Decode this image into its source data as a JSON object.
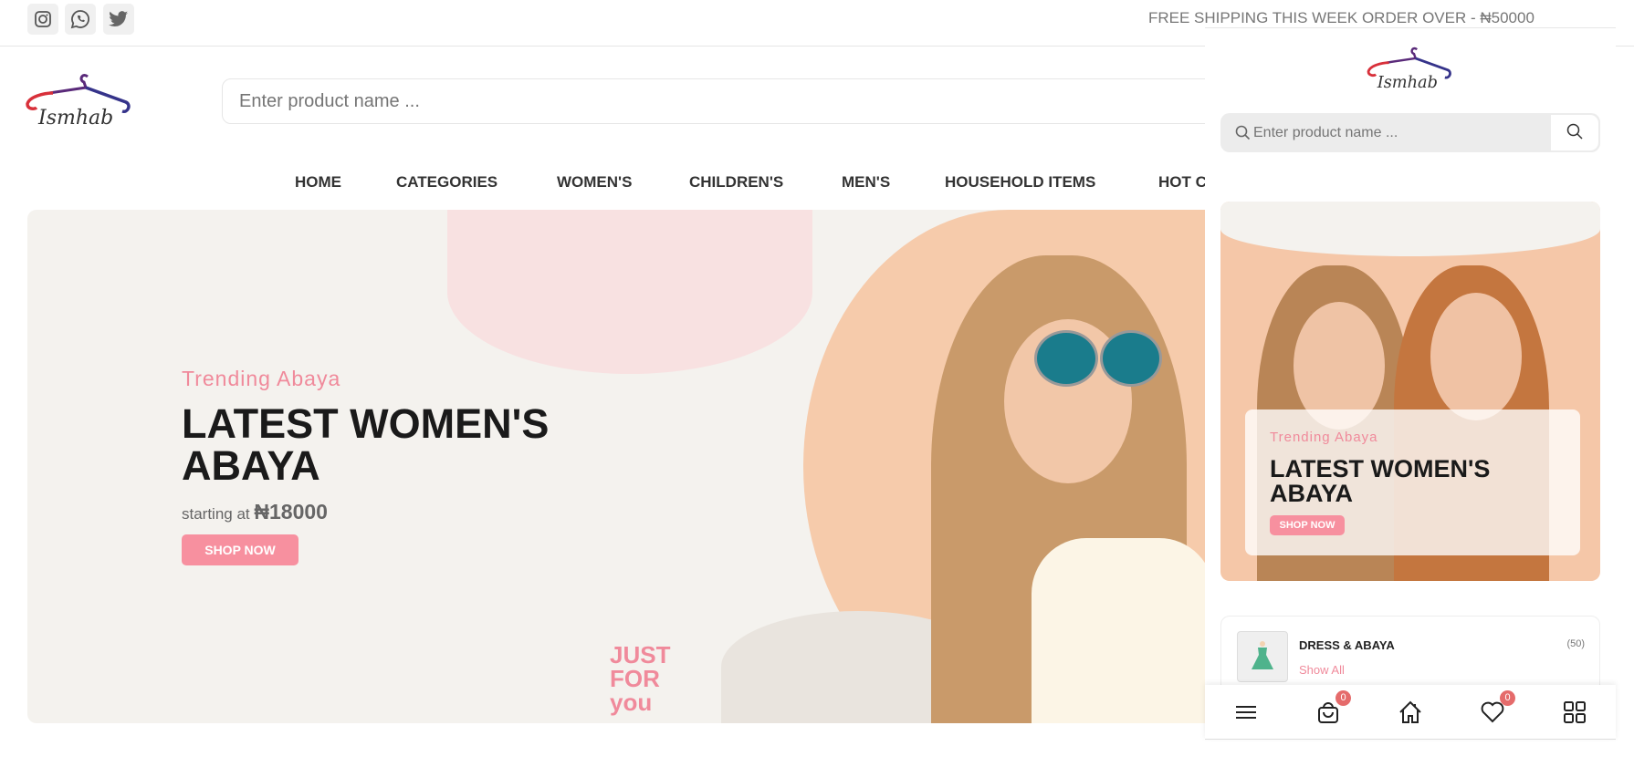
{
  "topbar": {
    "social": [
      "instagram-icon",
      "whatsapp-icon",
      "twitter-icon"
    ],
    "shipping_text": "FREE SHIPPING THIS WEEK ORDER OVER - ₦50000"
  },
  "header": {
    "logo_text": "Ismhab",
    "search_placeholder": "Enter product name ..."
  },
  "nav": [
    "HOME",
    "CATEGORIES",
    "WOMEN'S",
    "CHILDREN'S",
    "MEN'S",
    "HOUSEHOLD ITEMS",
    "HOT C"
  ],
  "hero": {
    "subtitle": "Trending Abaya",
    "title": "LATEST WOMEN'S ABAYA",
    "price_prefix": "starting at",
    "price": "₦18000",
    "button": "SHOP NOW",
    "badge_text": "JUST FOR you"
  },
  "mobile": {
    "logo_text": "Ismhab",
    "search_placeholder": "Enter product name ...",
    "hero": {
      "subtitle": "Trending Abaya",
      "title": "LATEST WOMEN'S ABAYA",
      "button": "SHOP NOW"
    },
    "category": {
      "name": "DRESS & ABAYA",
      "count": "(50)",
      "link": "Show All"
    },
    "bottom_nav": [
      {
        "icon": "menu-icon"
      },
      {
        "icon": "bag-icon",
        "badge": "0"
      },
      {
        "icon": "home-icon"
      },
      {
        "icon": "heart-icon",
        "badge": "0"
      },
      {
        "icon": "grid-icon"
      }
    ]
  },
  "colors": {
    "accent": "#f7909f",
    "badge": "#e56b6b"
  }
}
